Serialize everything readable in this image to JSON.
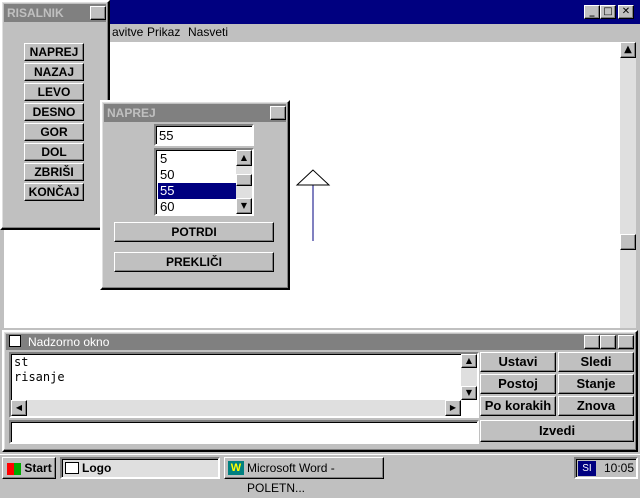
{
  "main_window": {
    "menu": [
      "avitve",
      "Prikaz",
      "Nasveti"
    ]
  },
  "risalnik": {
    "title": "RISALNIK",
    "buttons": [
      "NAPREJ",
      "NAZAJ",
      "LEVO",
      "DESNO",
      "GOR",
      "DOL",
      "ZBRIŠI",
      "KONČAJ"
    ]
  },
  "naprej_dialog": {
    "title": "NAPREJ",
    "input_value": "55",
    "list_items": [
      "5",
      "50",
      "55",
      "60"
    ],
    "selected_item": "55",
    "confirm_label": "POTRDI",
    "cancel_label": "PREKLIČI"
  },
  "watch_window": {
    "title": "Nadzorno okno",
    "lines": [
      "st",
      "risanje"
    ],
    "command_value": "",
    "buttons": {
      "ustavi": "Ustavi",
      "sledi": "Sledi",
      "postoj": "Postoj",
      "stanje": "Stanje",
      "po_korakih": "Po korakih",
      "znova": "Znova",
      "izvedi": "Izvedi"
    }
  },
  "taskbar": {
    "start_label": "Start",
    "tasks": [
      "Logo",
      "Microsoft Word - POLETN..."
    ],
    "tray_indicator": "SI",
    "clock": "10:05"
  },
  "colors": {
    "active_title": "#000080",
    "inactive_title": "#808080",
    "turtle": "#000080"
  },
  "icons": [
    "minimize-icon",
    "maximize-icon",
    "close-icon",
    "word-icon",
    "windows-logo-icon",
    "logo-app-icon"
  ]
}
